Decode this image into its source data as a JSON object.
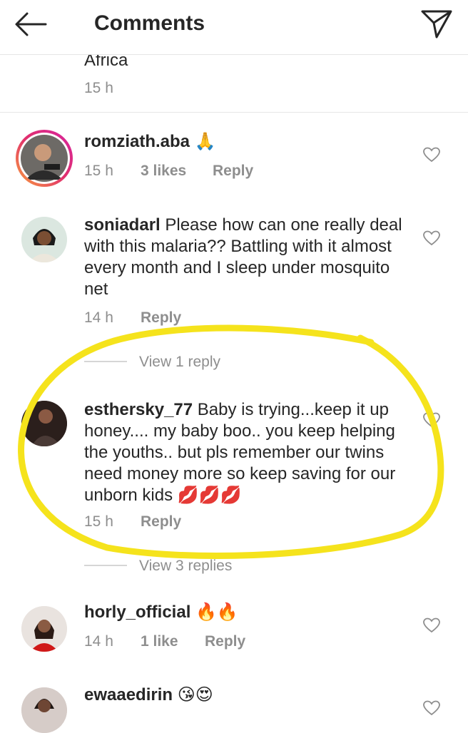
{
  "header": {
    "title": "Comments"
  },
  "top_comment": {
    "text_tail": "Africa",
    "time": "15 h"
  },
  "comments": [
    {
      "username": "romziath.aba",
      "text": " 🙏",
      "time": "15 h",
      "likes": "3 likes",
      "reply": "Reply"
    },
    {
      "username": "soniadarl",
      "text": " Please how can one really deal with this malaria?? Battling with it almost every month and I sleep under mosquito net",
      "time": "14 h",
      "reply": "Reply",
      "view_replies": "View 1 reply"
    },
    {
      "username": "esthersky_77",
      "text": " Baby is trying...keep it up honey.... my baby boo.. you keep helping the youths.. but pls remember our twins need money more so keep saving for our unborn kids 💋💋💋",
      "time": "15 h",
      "reply": "Reply",
      "view_replies": "View 3 replies"
    },
    {
      "username": "horly_official",
      "text": " 🔥🔥",
      "time": "14 h",
      "likes": "1 like",
      "reply": "Reply"
    },
    {
      "username": "ewaaedirin",
      "text": " 😘😍"
    }
  ],
  "colors": {
    "highlight": "#f5e31c",
    "ring_start": "#f9a13b",
    "ring_end": "#d6249f"
  }
}
